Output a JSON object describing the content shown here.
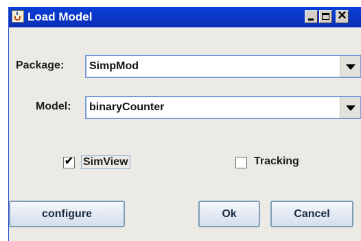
{
  "window": {
    "title": "Load Model"
  },
  "titlebar_buttons": {
    "minimize": "minimize-icon",
    "maximize": "maximize-icon",
    "close": "close-icon",
    "close_glyph": "✕"
  },
  "package": {
    "label": "Package:",
    "selected": "SimpMod"
  },
  "model": {
    "label": "Model:",
    "selected": "binaryCounter"
  },
  "options": {
    "simview": {
      "label": "SimView",
      "checked": true,
      "check_glyph": "✔"
    },
    "tracking": {
      "label": "Tracking",
      "checked": false
    }
  },
  "buttons": {
    "configure": "configure",
    "ok": "Ok",
    "cancel": "Cancel"
  },
  "colors": {
    "titlebar": "#0a36c9",
    "dialog_bg": "#eceae4",
    "button_border": "#7f9db9"
  }
}
